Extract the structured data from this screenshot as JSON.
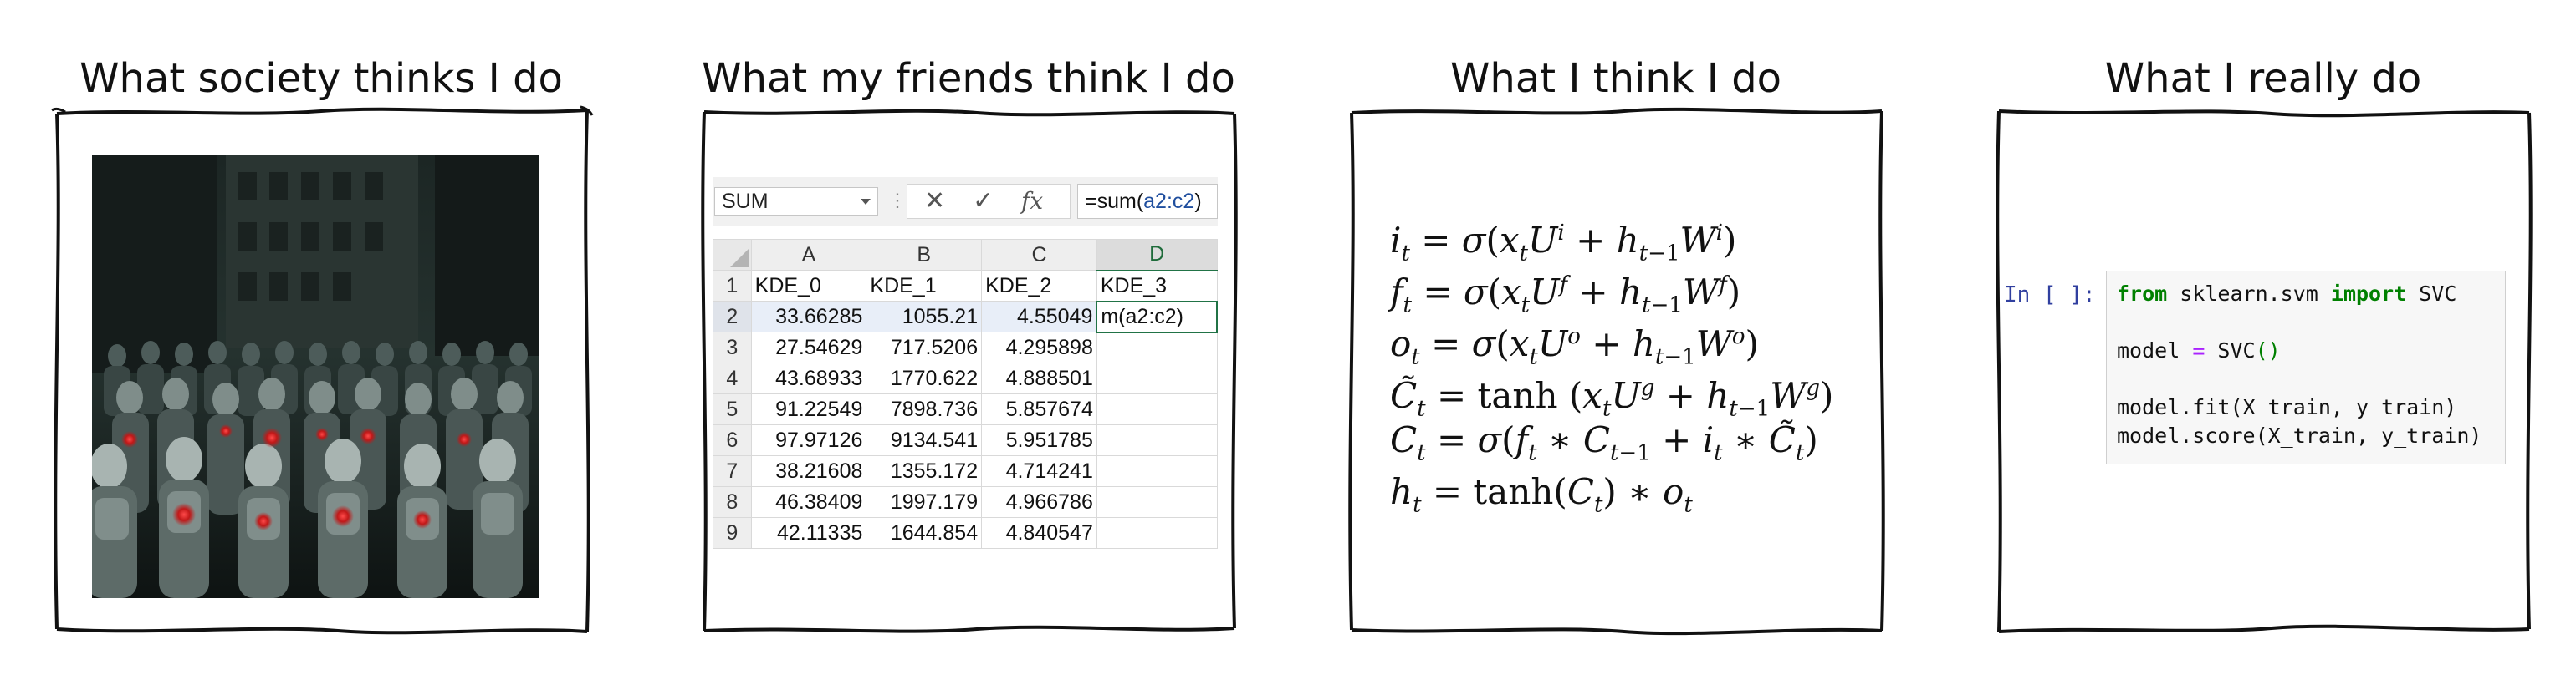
{
  "panels": [
    {
      "title": "What society thinks I do"
    },
    {
      "title": "What my friends think I do"
    },
    {
      "title": "What I think I do"
    },
    {
      "title": "What I really do"
    }
  ],
  "spreadsheet": {
    "name_box": "SUM",
    "cancel_icon": "✕",
    "enter_icon": "✓",
    "fx_label": "fx",
    "formula_prefix": "=sum(",
    "formula_ref1": "a2",
    "formula_sep": ":",
    "formula_ref2": "c2",
    "formula_suffix": ")",
    "columns": [
      "A",
      "B",
      "C",
      "D"
    ],
    "row_numbers": [
      "1",
      "2",
      "3",
      "4",
      "5",
      "6",
      "7",
      "8",
      "9"
    ],
    "header_row": [
      "KDE_0",
      "KDE_1",
      "KDE_2",
      "KDE_3"
    ],
    "rows": [
      [
        "33.66285",
        "1055.21",
        "4.55049",
        "m(a2:c2)"
      ],
      [
        "27.54629",
        "717.5206",
        "4.295898",
        ""
      ],
      [
        "43.68933",
        "1770.622",
        "4.888501",
        ""
      ],
      [
        "91.22549",
        "7898.736",
        "5.857674",
        ""
      ],
      [
        "97.97126",
        "9134.541",
        "5.951785",
        ""
      ],
      [
        "38.21608",
        "1355.172",
        "4.714241",
        ""
      ],
      [
        "46.38409",
        "1997.179",
        "4.966786",
        ""
      ],
      [
        "42.11335",
        "1644.854",
        "4.840547",
        ""
      ]
    ]
  },
  "equations": {
    "i": {
      "lhs": "i",
      "gate": "i"
    },
    "f": {
      "lhs": "f",
      "gate": "f"
    },
    "o": {
      "lhs": "o",
      "gate": "o"
    },
    "g": {
      "lhs": "C̃",
      "gate": "g"
    },
    "c": {
      "lhs": "C"
    },
    "h": {
      "lhs": "h"
    }
  },
  "notebook": {
    "prompt": "In [ ]:",
    "lines": [
      {
        "kw1": "from",
        "t1": " sklearn.svm ",
        "kw2": "import",
        "t2": " SVC"
      },
      {
        "t1": "model ",
        "op": "=",
        "t2": " SVC",
        "paren": "()"
      },
      {
        "t1": "model.fit(X_train, y_train)"
      },
      {
        "t1": "model.score(X_train, y_train)"
      }
    ]
  },
  "colors": {
    "excel_green": "#217346",
    "jupyter_prompt": "#303f9f",
    "python_keyword": "#008000",
    "python_operator": "#aa22ff"
  }
}
